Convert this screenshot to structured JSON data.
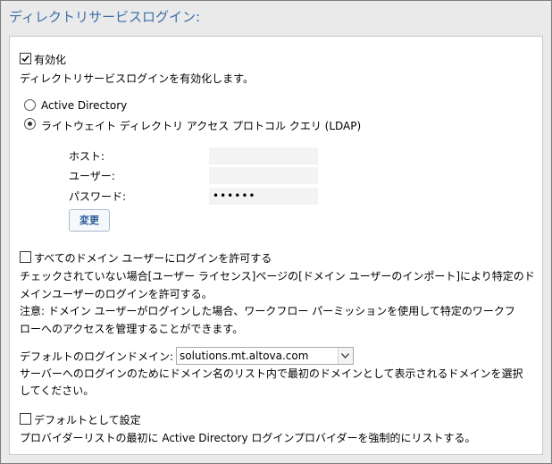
{
  "section_title": "ディレクトリサービスログイン:",
  "enable": {
    "label": "有効化",
    "checked": true,
    "description": "ディレクトリサービスログインを有効化します。"
  },
  "auth_type": {
    "options": [
      {
        "label": "Active Directory",
        "selected": false
      },
      {
        "label": "ライトウェイト ディレクトリ アクセス プロトコル クエリ (LDAP)",
        "selected": true
      }
    ]
  },
  "ldap": {
    "host_label": "ホスト:",
    "host_value": "",
    "user_label": "ユーザー:",
    "user_value": "",
    "password_label": "パスワード:",
    "password_value": "••••••",
    "change_button": "変更"
  },
  "allow_all": {
    "label": "すべてのドメイン ユーザーにログインを許可する",
    "checked": false,
    "desc_line1": "チェックされていない場合[ユーザー ライセンス]ページの[ドメイン ユーザーのインポート]により特定のド",
    "desc_line2": "メインユーザーのログインを許可する。",
    "note_line1": "注意: ドメイン ユーザーがログインした場合、ワークフロー パーミッションを使用して特定のワークフ",
    "note_line2": "ローへのアクセスを管理することができます。"
  },
  "default_domain": {
    "label": "デフォルトのログインドメイン:",
    "selected": "solutions.mt.altova.com",
    "desc_line1": "サーバーへのログインのためにドメイン名のリスト内で最初のドメインとして表示されるドメインを選択",
    "desc_line2": "してください。"
  },
  "set_default": {
    "label": "デフォルトとして設定",
    "checked": false,
    "description": "プロバイダーリストの最初に Active Directory ログインプロバイダーを強制的にリストする。"
  }
}
